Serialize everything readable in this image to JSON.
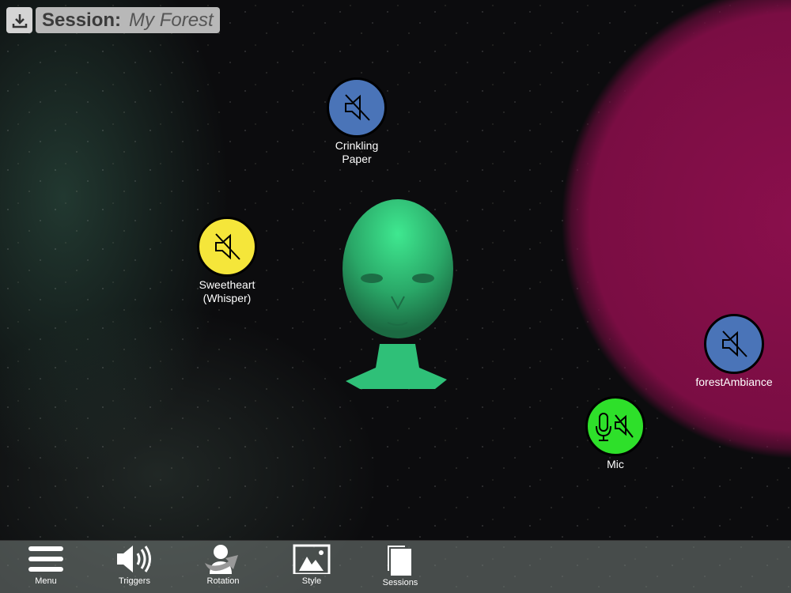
{
  "session": {
    "label": "Session:",
    "name": "My Forest"
  },
  "nodes": [
    {
      "label": "Crinkling Paper",
      "color": "#4a74b8"
    },
    {
      "label": "Sweetheart (Whisper)",
      "color": "#f5e63a"
    },
    {
      "label": "forestAmbiance",
      "color": "#4a74b8"
    },
    {
      "label": "Mic",
      "color": "#2ee02a"
    }
  ],
  "toolbar": {
    "menu": "Menu",
    "triggers": "Triggers",
    "rotation": "Rotation",
    "style": "Style",
    "sessions": "Sessions"
  }
}
